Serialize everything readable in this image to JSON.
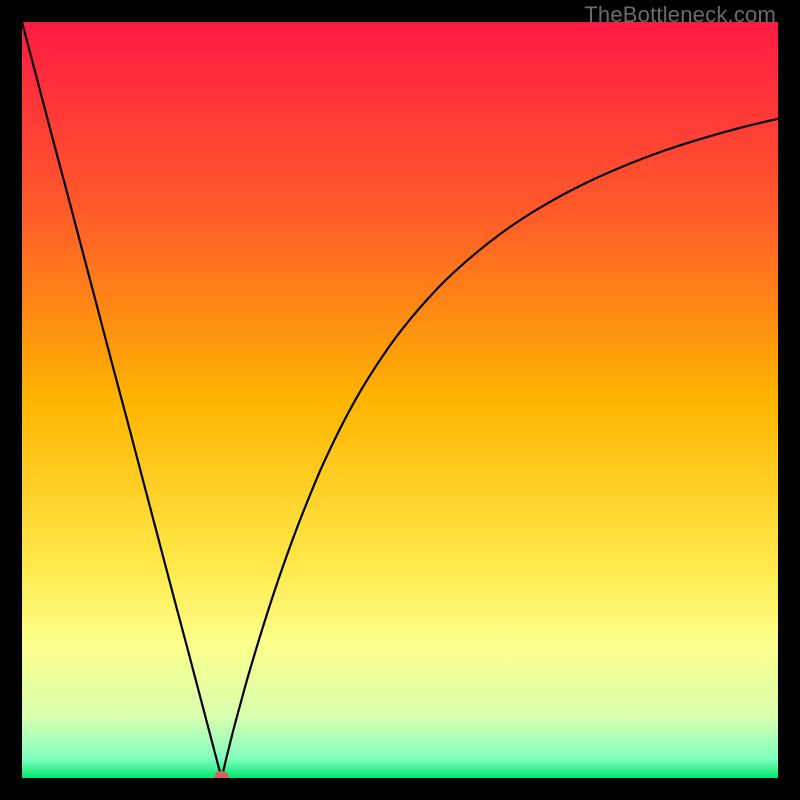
{
  "watermark": "TheBottleneck.com",
  "chart_data": {
    "type": "line",
    "title": "",
    "xlabel": "",
    "ylabel": "",
    "xlim": [
      0,
      100
    ],
    "ylim": [
      0,
      100
    ],
    "gradient_stops": [
      {
        "pos": 0.0,
        "color": "#ff1a44"
      },
      {
        "pos": 0.25,
        "color": "#ff5a2a"
      },
      {
        "pos": 0.5,
        "color": "#ffb400"
      },
      {
        "pos": 0.72,
        "color": "#ffe94a"
      },
      {
        "pos": 0.82,
        "color": "#fdff8a"
      },
      {
        "pos": 0.92,
        "color": "#d8ffb0"
      },
      {
        "pos": 0.975,
        "color": "#7fffbf"
      },
      {
        "pos": 1.0,
        "color": "#00e56b"
      }
    ],
    "minimum_marker": {
      "x": 26.4,
      "y": 0,
      "color": "#d1635f"
    },
    "series": [
      {
        "name": "left-branch",
        "x": [
          0,
          2,
          4,
          6,
          8,
          10,
          12,
          14,
          16,
          18,
          20,
          22,
          24,
          25,
          26,
          26.4
        ],
        "y": [
          100,
          92.4,
          84.8,
          77.3,
          69.7,
          62.1,
          54.5,
          47.0,
          39.4,
          31.8,
          24.2,
          16.7,
          9.1,
          5.3,
          1.5,
          0
        ]
      },
      {
        "name": "right-branch",
        "x": [
          26.4,
          27,
          28,
          29,
          30,
          32,
          34,
          36,
          38,
          40,
          43,
          46,
          50,
          55,
          60,
          65,
          70,
          75,
          80,
          85,
          90,
          95,
          100
        ],
        "y": [
          0,
          2.5,
          6.5,
          10.2,
          13.8,
          20.4,
          26.5,
          32.1,
          37.2,
          41.9,
          48.0,
          53.2,
          59.0,
          64.8,
          69.4,
          73.2,
          76.3,
          78.9,
          81.1,
          83.0,
          84.6,
          86.0,
          87.2
        ]
      }
    ]
  }
}
